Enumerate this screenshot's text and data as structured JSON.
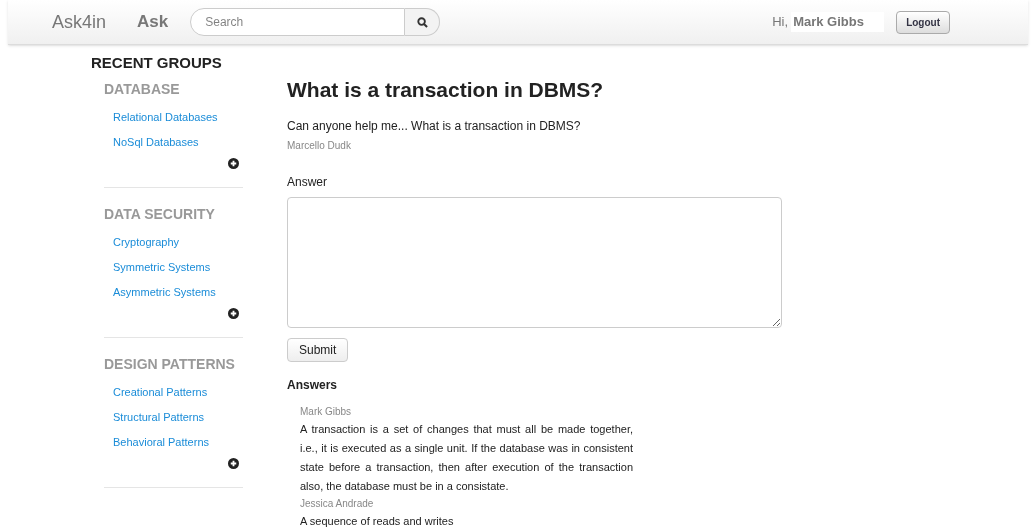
{
  "navbar": {
    "brand": "Ask4in",
    "links": [
      "Ask"
    ],
    "search": {
      "placeholder": "Search"
    },
    "greeting": "Hi,",
    "user": "Mark Gibbs",
    "logout": "Logout"
  },
  "sidebar": {
    "title": "RECENT GROUPS",
    "groups": [
      {
        "name": "DATABASE",
        "items": [
          "Relational Databases",
          "NoSql Databases"
        ]
      },
      {
        "name": "DATA SECURITY",
        "items": [
          "Cryptography",
          "Symmetric Systems",
          "Asymmetric Systems"
        ]
      },
      {
        "name": "DESIGN PATTERNS",
        "items": [
          "Creational Patterns",
          "Structural Patterns",
          "Behavioral Patterns"
        ]
      }
    ]
  },
  "question": {
    "title": "What is a transaction in DBMS?",
    "body": "Can anyone help me... What is a transaction in DBMS?",
    "author": "Marcello Dudk"
  },
  "answer_form": {
    "label": "Answer",
    "submit": "Submit"
  },
  "answers": {
    "title": "Answers",
    "items": [
      {
        "author": "Mark Gibbs",
        "text": "A transaction is a set of changes that must all be made together, i.e., it is executed as a single unit. If the database was in consistent state before a transaction, then after execution of the transaction also, the database must be in a consistate."
      },
      {
        "author": "Jessica Andrade",
        "text": "A sequence of reads and writes"
      }
    ]
  }
}
